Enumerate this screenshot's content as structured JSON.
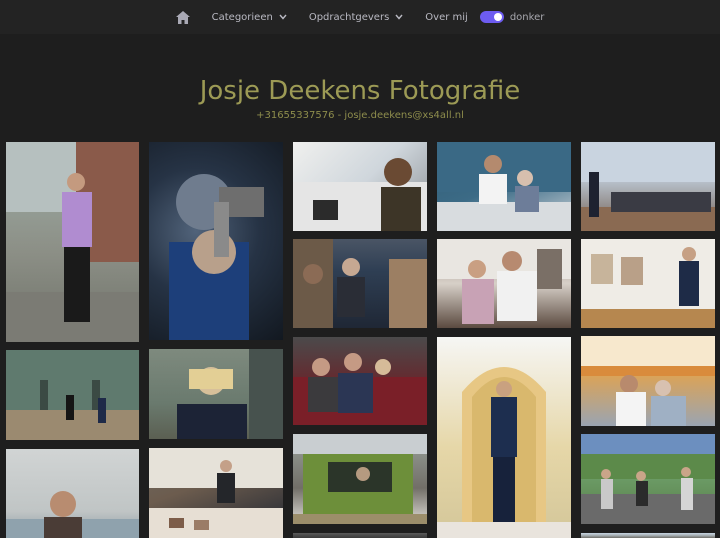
{
  "nav": {
    "home_icon": "home-icon",
    "categories_label": "Categorieen",
    "clients_label": "Opdrachtgevers",
    "about_label": "Over mij",
    "dark_toggle_on": true,
    "dark_label": "donker",
    "accent": "#6d5cf0"
  },
  "header": {
    "title": "Josje Deekens Fotografie",
    "contact": "+31655337576 - josje.deekens@xs4all.nl",
    "title_color": "#9c9a55"
  },
  "gallery": {
    "photos": [
      {
        "name": "man-purple-cardigan-street"
      },
      {
        "name": "man-pointing-gun"
      },
      {
        "name": "woman-headset-office"
      },
      {
        "name": "nurse-elderly-woman"
      },
      {
        "name": "meeting-room-presentation"
      },
      {
        "name": "men-conversation-cafe"
      },
      {
        "name": "woman-girl-hospital"
      },
      {
        "name": "man-museum-gallery"
      },
      {
        "name": "people-running-plaza"
      },
      {
        "name": "blonde-woman-portrait"
      },
      {
        "name": "couple-bus-seats"
      },
      {
        "name": "man-suit-archway"
      },
      {
        "name": "woman-caregiver-elderly"
      },
      {
        "name": "man-beach-portrait"
      },
      {
        "name": "man-workshop-photos"
      },
      {
        "name": "man-tractor"
      },
      {
        "name": "people-cycling-street"
      }
    ]
  }
}
